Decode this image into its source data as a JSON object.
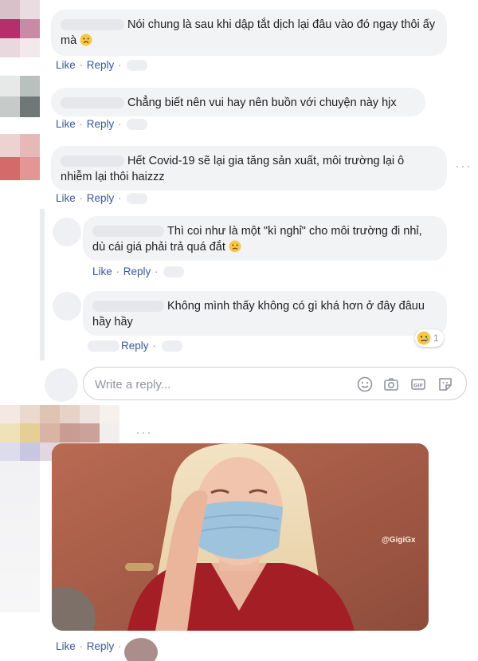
{
  "comments": [
    {
      "text": "Nói chung là sau khi dập tắt dịch lại đâu vào đó ngay thôi ấy mà",
      "like": "Like",
      "reply": "Reply"
    },
    {
      "text": "Chẳng biết nên vui hay nên buồn với chuyện này hjx",
      "like": "Like",
      "reply": "Reply"
    },
    {
      "text": "Hết Covid-19 sẽ lại gia tăng sản xuất, môi trường lại ô nhiễm lại thôi haizzz",
      "like": "Like",
      "reply": "Reply"
    }
  ],
  "replies": [
    {
      "text": "Thì coi như là một \"kì nghỉ\" cho môi trường đi nhỉ, dù cái giá phải trả quá đắt",
      "like": "Like",
      "reply": "Reply"
    },
    {
      "text": "Không mình thấy không có gì khá hơn ở đây đâuu hầy hầy",
      "reply": "Reply",
      "reaction_count": "1"
    }
  ],
  "reply_box": {
    "placeholder": "Write a reply..."
  },
  "gif_comment": {
    "watermark": "@GigiGx",
    "like": "Like",
    "reply": "Reply"
  },
  "icons": [
    "sad-face-emoji",
    "smiley-icon",
    "camera-icon",
    "gif-icon",
    "sticker-icon",
    "more-dots-icon"
  ],
  "colors": {
    "link": "#385898",
    "bubble": "#f2f3f5",
    "meta": "#90949c",
    "gif_background": "#a15a45"
  }
}
